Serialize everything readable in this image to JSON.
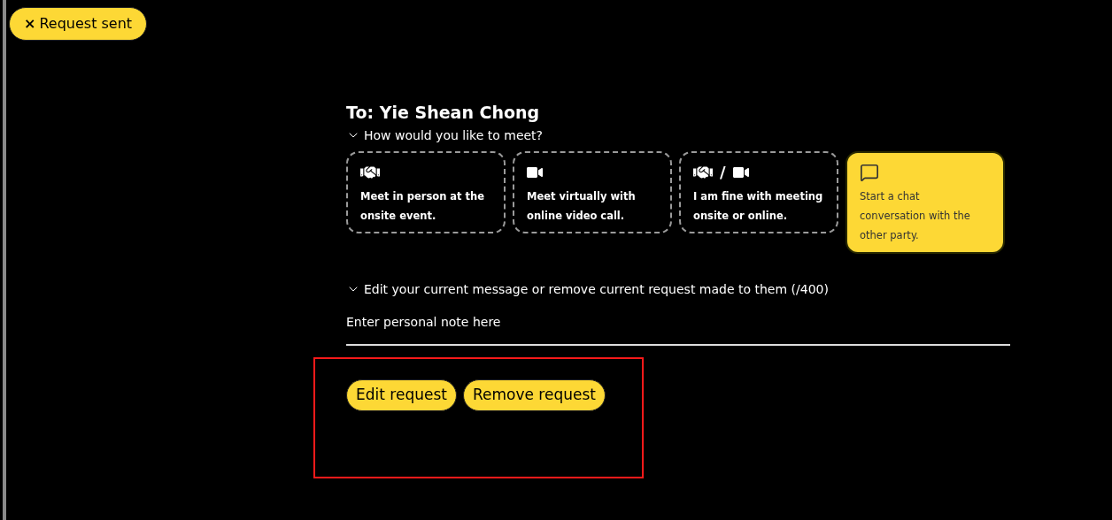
{
  "status_chip": {
    "icon_glyph": "×",
    "label": "Request sent"
  },
  "recipient": "To: Yie Shean Chong",
  "meet_section": {
    "heading": "How would you like to meet?",
    "expanded": true,
    "options": [
      {
        "kind": "in_person",
        "text": "Meet in person at the onsite event.",
        "selected": false
      },
      {
        "kind": "virtual",
        "text": "Meet virtually with online video call.",
        "selected": false
      },
      {
        "kind": "either",
        "separator": "/",
        "text": "I am fine with meeting onsite or online.",
        "selected": false
      },
      {
        "kind": "chat",
        "text": "Start a chat conversation with the other party.",
        "selected": true
      }
    ]
  },
  "message_section": {
    "heading": "Edit your current message or remove current request made to them (/400)",
    "expanded": true,
    "note": {
      "placeholder": "Enter personal note here"
    }
  },
  "buttons": [
    "Edit request",
    "Remove request"
  ],
  "highlight": {
    "color": "#ff1a1a"
  }
}
